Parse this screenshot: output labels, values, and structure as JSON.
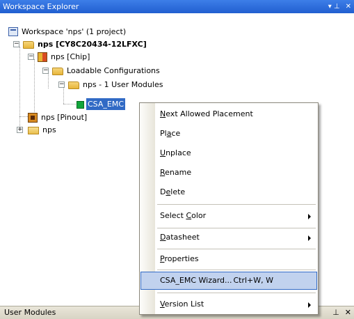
{
  "panel": {
    "title": "Workspace Explorer",
    "pin_glyph": "▾ ⊥",
    "close_glyph": "✕"
  },
  "tree": {
    "workspace": "Workspace 'nps' (1 project)",
    "project": "nps [CY8C20434-12LFXC]",
    "chip": "nps [Chip]",
    "loadable": "Loadable Configurations",
    "user_modules": "nps - 1 User Modules",
    "module": "CSA_EMC",
    "pinout": "nps [Pinout]",
    "folder": "nps",
    "expander_minus": "−",
    "expander_plus": "+"
  },
  "context_menu": {
    "next_allowed": {
      "pre": "",
      "u": "N",
      "post": "ext Allowed Placement"
    },
    "place": {
      "pre": "Pl",
      "u": "a",
      "post": "ce"
    },
    "unplace": {
      "pre": "",
      "u": "U",
      "post": "nplace"
    },
    "rename": {
      "pre": "",
      "u": "R",
      "post": "ename"
    },
    "delete": {
      "pre": "D",
      "u": "e",
      "post": "lete"
    },
    "select_color": {
      "pre": "Select ",
      "u": "C",
      "post": "olor"
    },
    "datasheet": {
      "pre": "",
      "u": "D",
      "post": "atasheet"
    },
    "properties": {
      "pre": "",
      "u": "P",
      "post": "roperties"
    },
    "wizard": {
      "label": "CSA_EMC Wizard...",
      "shortcut": "Ctrl+W, W"
    },
    "version_list": {
      "pre": "",
      "u": "V",
      "post": "ersion List"
    }
  },
  "bottom_panel": {
    "title": "User Modules",
    "pin_glyph": "⊥",
    "close_glyph": "✕"
  },
  "colors": {
    "titlebar": "#215fd0",
    "selection": "#316ac5",
    "menu_highlight": "#c1d2ee",
    "module_icon": "#11a53a"
  }
}
